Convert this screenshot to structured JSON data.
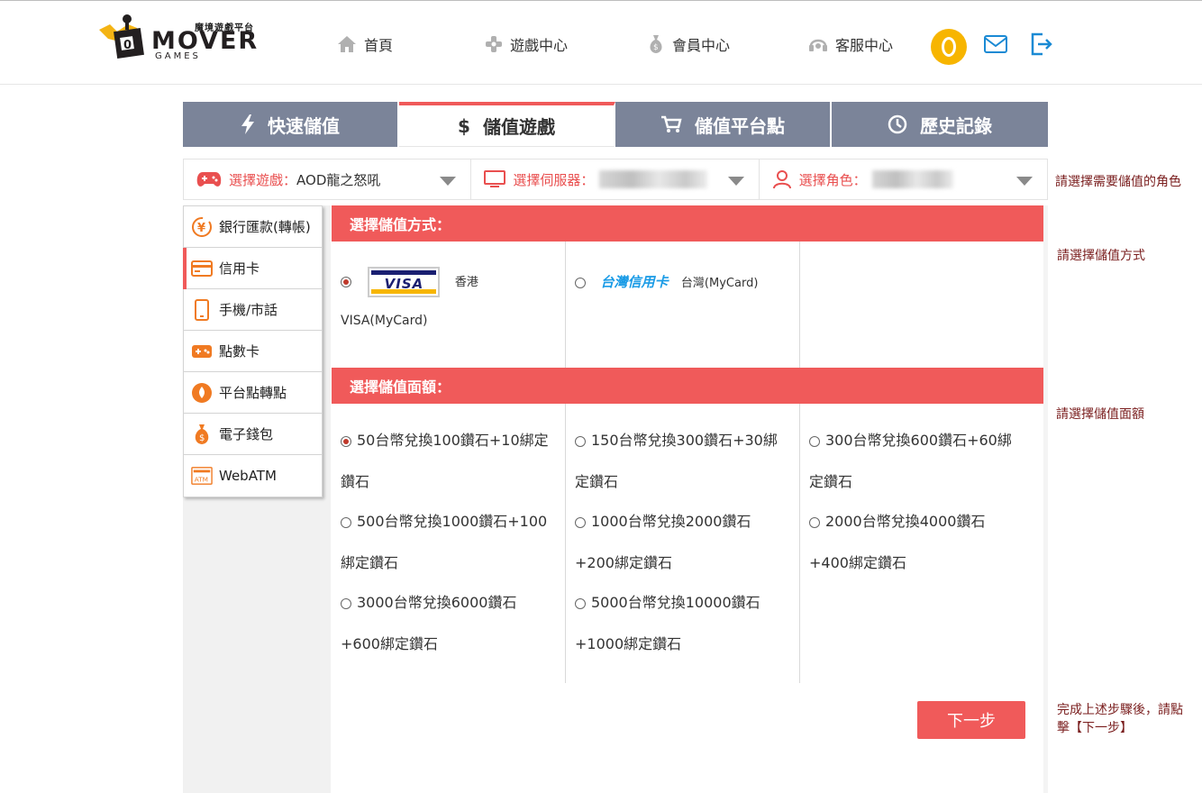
{
  "header": {
    "logo": {
      "tagline": "魔境遊戲平台",
      "wordmark": "MOVER",
      "sub": "GAMES"
    },
    "nav": [
      {
        "label": "首頁",
        "icon": "home-icon"
      },
      {
        "label": "遊戲中心",
        "icon": "gamepad-icon"
      },
      {
        "label": "會員中心",
        "icon": "moneybag-icon"
      },
      {
        "label": "客服中心",
        "icon": "headset-icon"
      }
    ],
    "icons": [
      "coin-icon",
      "mail-icon",
      "logout-icon"
    ]
  },
  "tabs": [
    {
      "label": "快速儲值",
      "icon": "lightning-icon",
      "active": false
    },
    {
      "label": "儲值遊戲",
      "icon": "dollar-icon",
      "active": true
    },
    {
      "label": "儲值平台點",
      "icon": "cart-icon",
      "active": false
    },
    {
      "label": "歷史記錄",
      "icon": "clock-icon",
      "active": false
    }
  ],
  "selectors": {
    "game": {
      "label": "選擇遊戲：",
      "value": "AOD龍之怒吼"
    },
    "server": {
      "label": "選擇伺服器："
    },
    "role": {
      "label": "選擇角色："
    }
  },
  "notes": {
    "role": "請選擇需要儲值的角色",
    "method": "請選擇儲值方式",
    "amount": "請選擇儲值面額",
    "next_line1": "完成上述步驟後，請點",
    "next_line2": "擊【下一步】"
  },
  "methods": [
    {
      "label": "銀行匯款(轉帳)",
      "icon": "yen-transfer-icon",
      "active": false
    },
    {
      "label": "信用卡",
      "icon": "credit-card-icon",
      "active": true
    },
    {
      "label": "手機/市話",
      "icon": "phone-icon",
      "active": false
    },
    {
      "label": "點數卡",
      "icon": "point-card-icon",
      "active": false
    },
    {
      "label": "平台點轉點",
      "icon": "platform-point-icon",
      "active": false
    },
    {
      "label": "電子錢包",
      "icon": "wallet-icon",
      "active": false
    },
    {
      "label": "WebATM",
      "icon": "atm-icon",
      "active": false
    }
  ],
  "payment": {
    "header": "選擇儲值方式：",
    "options": [
      {
        "logo_text": "VISA",
        "region": "香港",
        "label": "VISA(MyCard)",
        "selected": true
      },
      {
        "logo_text": "台灣信用卡",
        "label": "台灣(MyCard)",
        "selected": false
      }
    ]
  },
  "amount": {
    "header": "選擇儲值面額：",
    "columns": [
      [
        {
          "line1": "50台幣兌換100鑽石+10綁定",
          "line2": "鑽石",
          "selected": true
        },
        {
          "line1": "500台幣兌換1000鑽石+100",
          "line2": "綁定鑽石",
          "selected": false
        },
        {
          "line1": "3000台幣兌換6000鑽石",
          "line2": "+600綁定鑽石",
          "selected": false
        }
      ],
      [
        {
          "line1": "150台幣兌換300鑽石+30綁",
          "line2": "定鑽石",
          "selected": false
        },
        {
          "line1": "1000台幣兌換2000鑽石",
          "line2": "+200綁定鑽石",
          "selected": false
        },
        {
          "line1": "5000台幣兌換10000鑽石",
          "line2": "+1000綁定鑽石",
          "selected": false
        }
      ],
      [
        {
          "line1": "300台幣兌換600鑽石+60綁",
          "line2": "定鑽石",
          "selected": false
        },
        {
          "line1": "2000台幣兌換4000鑽石",
          "line2": "+400綁定鑽石",
          "selected": false
        }
      ]
    ]
  },
  "next_button": "下一步",
  "colors": {
    "accent": "#f05a5a",
    "tab_bg": "#7b8499",
    "coin": "#f7b500",
    "link_blue": "#1a9be6"
  }
}
